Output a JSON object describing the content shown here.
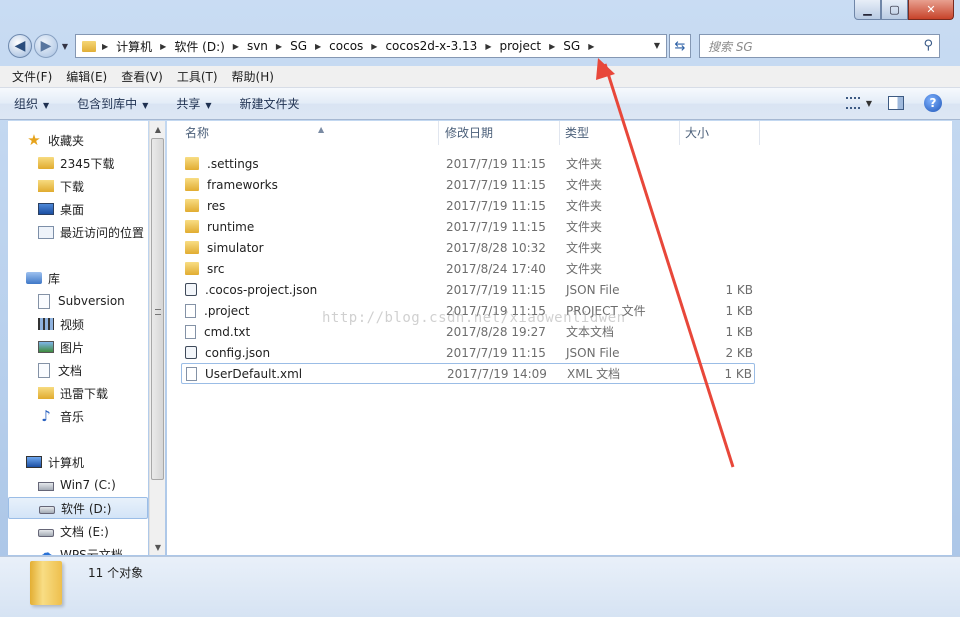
{
  "window": {
    "caption_buttons": {
      "minimize": "▁",
      "maximize": "▢",
      "close": "✕"
    }
  },
  "nav": {
    "back_glyph": "◀",
    "forward_glyph": "▶",
    "breadcrumbs": [
      "计算机",
      "软件 (D:)",
      "svn",
      "SG",
      "cocos",
      "cocos2d-x-3.13",
      "project",
      "SG"
    ],
    "search_placeholder": "搜索 SG"
  },
  "menu": [
    "文件(F)",
    "编辑(E)",
    "查看(V)",
    "工具(T)",
    "帮助(H)"
  ],
  "toolbar": {
    "organize": "组织",
    "include_library": "包含到库中",
    "share": "共享",
    "new_folder": "新建文件夹",
    "help_glyph": "?"
  },
  "sidebar": {
    "favorites": [
      {
        "label": "收藏夹",
        "icon": "star-icon"
      },
      {
        "label": "2345下载",
        "icon": "folder-icon"
      },
      {
        "label": "下载",
        "icon": "download-folder-icon"
      },
      {
        "label": "桌面",
        "icon": "desktop-icon"
      },
      {
        "label": "最近访问的位置",
        "icon": "recent-places-icon"
      }
    ],
    "libraries": [
      {
        "label": "库",
        "icon": "libraries-icon"
      },
      {
        "label": "Subversion",
        "icon": "document-library-icon"
      },
      {
        "label": "视频",
        "icon": "video-icon"
      },
      {
        "label": "图片",
        "icon": "pictures-icon"
      },
      {
        "label": "文档",
        "icon": "documents-icon"
      },
      {
        "label": "迅雷下载",
        "icon": "download-folder-icon"
      },
      {
        "label": "音乐",
        "icon": "music-icon"
      }
    ],
    "computer": [
      {
        "label": "计算机",
        "icon": "computer-icon"
      },
      {
        "label": "Win7 (C:)",
        "icon": "system-drive-icon"
      },
      {
        "label": "软件 (D:)",
        "icon": "drive-icon"
      },
      {
        "label": "文档 (E:)",
        "icon": "drive-icon"
      },
      {
        "label": "WPS云文档",
        "icon": "cloud-icon"
      }
    ]
  },
  "columns": {
    "name": "名称",
    "date": "修改日期",
    "type": "类型",
    "size": "大小"
  },
  "files": [
    {
      "name": ".settings",
      "date": "2017/7/19 11:15",
      "type": "文件夹",
      "size": "",
      "icon": "folder"
    },
    {
      "name": "frameworks",
      "date": "2017/7/19 11:15",
      "type": "文件夹",
      "size": "",
      "icon": "folder"
    },
    {
      "name": "res",
      "date": "2017/7/19 11:15",
      "type": "文件夹",
      "size": "",
      "icon": "folder"
    },
    {
      "name": "runtime",
      "date": "2017/7/19 11:15",
      "type": "文件夹",
      "size": "",
      "icon": "folder"
    },
    {
      "name": "simulator",
      "date": "2017/8/28 10:32",
      "type": "文件夹",
      "size": "",
      "icon": "folder"
    },
    {
      "name": "src",
      "date": "2017/8/24 17:40",
      "type": "文件夹",
      "size": "",
      "icon": "folder"
    },
    {
      "name": ".cocos-project.json",
      "date": "2017/7/19 11:15",
      "type": "JSON File",
      "size": "1 KB",
      "icon": "json"
    },
    {
      "name": ".project",
      "date": "2017/7/19 11:15",
      "type": "PROJECT 文件",
      "size": "1 KB",
      "icon": "file"
    },
    {
      "name": "cmd.txt",
      "date": "2017/8/28 19:27",
      "type": "文本文档",
      "size": "1 KB",
      "icon": "file"
    },
    {
      "name": "config.json",
      "date": "2017/7/19 11:15",
      "type": "JSON File",
      "size": "2 KB",
      "icon": "json"
    },
    {
      "name": "UserDefault.xml",
      "date": "2017/7/19 14:09",
      "type": "XML 文档",
      "size": "1 KB",
      "icon": "file"
    }
  ],
  "status": {
    "count_text": "11 个对象"
  },
  "watermark": "http://blog.csdn.net/xiaowenlidwen",
  "colors": {
    "annotation_arrow": "#e8473a",
    "selection_border": "#9bbde6"
  }
}
